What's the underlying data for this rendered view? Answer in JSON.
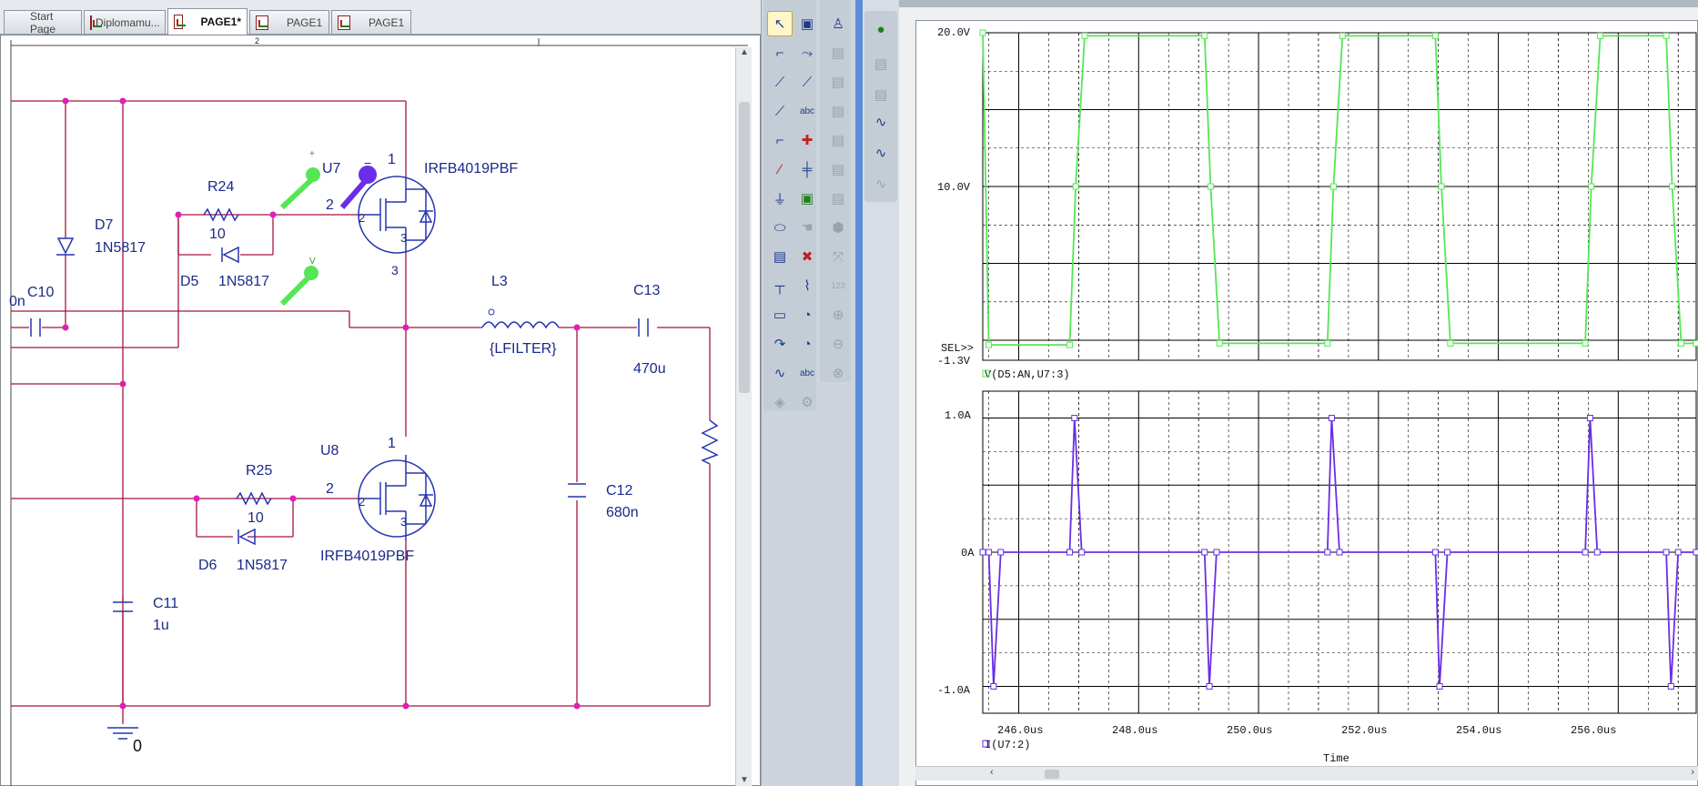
{
  "tabs": [
    {
      "label": "Start Page",
      "active": false
    },
    {
      "label": "Diplomamu...",
      "active": false
    },
    {
      "label": "PAGE1*",
      "active": true
    },
    {
      "label": "PAGE1",
      "active": false
    },
    {
      "label": "PAGE1",
      "active": false
    }
  ],
  "schematic": {
    "sheet_marker": "2",
    "left_fragment": "0n",
    "ground_label": "0",
    "components": {
      "d7": {
        "ref": "D7",
        "value": "1N5817"
      },
      "c10": {
        "ref": "C10"
      },
      "r24": {
        "ref": "R24",
        "value": "10"
      },
      "d5": {
        "ref": "D5",
        "value": "1N5817"
      },
      "u7": {
        "ref": "U7",
        "part": "IRFB4019PBF",
        "pin1": "1",
        "pin2": "2",
        "pin3": "3",
        "pin2b": "2",
        "pin3b": "3",
        "probe_minus": "−",
        "probe_plus": "+",
        "probe_v": "V"
      },
      "l3": {
        "ref": "L3",
        "value": "{LFILTER}"
      },
      "c13": {
        "ref": "C13",
        "value": "470u"
      },
      "u8": {
        "ref": "U8",
        "part": "IRFB4019PBF",
        "pin1": "1",
        "pin2": "2",
        "pin2b": "2",
        "pin3b": "3"
      },
      "r25": {
        "ref": "R25",
        "value": "10"
      },
      "d6": {
        "ref": "D6",
        "value": "1N5817"
      },
      "c12": {
        "ref": "C12",
        "value": "680n"
      },
      "c11": {
        "ref": "C11",
        "value": "1u"
      }
    }
  },
  "plot": {
    "colors": {
      "voltage": "#55e655",
      "current": "#6a2ee8",
      "grid": "#000000"
    },
    "voltage_plot": {
      "y_ticks": [
        "20.0V",
        "10.0V",
        "SEL>>",
        "-1.3V"
      ],
      "legend": "V(D5:AN,U7:3)"
    },
    "current_plot": {
      "y_ticks": [
        "1.0A",
        "0A",
        "-1.0A"
      ],
      "legend": "I(U7:2)"
    },
    "x_ticks": [
      "246.0us",
      "248.0us",
      "250.0us",
      "252.0us",
      "254.0us",
      "256.0us"
    ],
    "x_label": "Time",
    "chart_data": [
      {
        "type": "line",
        "x_unit": "us",
        "xlim": [
          245.4,
          257.3
        ],
        "ylim": [
          -1.3,
          20.0
        ],
        "series": [
          {
            "name": "V(D5:AN,U7:3)",
            "x": [
              245.4,
              245.5,
              246.85,
              246.95,
              247.1,
              249.1,
              249.2,
              249.35,
              251.15,
              251.25,
              251.4,
              252.95,
              253.05,
              253.2,
              255.45,
              255.55,
              255.7,
              256.8,
              256.9,
              257.05,
              257.3
            ],
            "y": [
              20.0,
              -0.3,
              -0.3,
              10.0,
              19.8,
              19.8,
              10.0,
              -0.2,
              -0.2,
              10.0,
              19.8,
              19.8,
              10.0,
              -0.2,
              -0.2,
              10.0,
              19.8,
              19.8,
              10.0,
              -0.2,
              -0.2
            ]
          }
        ]
      },
      {
        "type": "line",
        "x_unit": "us",
        "xlim": [
          245.4,
          257.3
        ],
        "ylim": [
          -1.2,
          1.2
        ],
        "series": [
          {
            "name": "I(U7:2)",
            "x": [
              245.4,
              245.5,
              245.58,
              245.7,
              246.85,
              246.93,
              247.05,
              249.1,
              249.18,
              249.3,
              251.15,
              251.22,
              251.35,
              252.95,
              253.02,
              253.15,
              255.45,
              255.53,
              255.65,
              256.8,
              256.88,
              257.0,
              257.3
            ],
            "y": [
              0.0,
              0.0,
              -1.0,
              0.0,
              0.0,
              1.0,
              0.0,
              0.0,
              -1.0,
              0.0,
              0.0,
              1.0,
              0.0,
              0.0,
              -1.0,
              0.0,
              0.0,
              1.0,
              0.0,
              0.0,
              -1.0,
              0.0,
              0.0
            ]
          }
        ]
      }
    ]
  },
  "palette_icons": [
    "select-icon",
    "place-part-icon",
    "wire-icon",
    "net-alias-icon",
    "bus-icon",
    "bus-entry-icon",
    "junction-icon",
    "no-connect-icon",
    "ground-icon",
    "power-icon",
    "off-page-icon",
    "hier-block-icon",
    "text-icon",
    "line-icon",
    "probe-icon"
  ]
}
